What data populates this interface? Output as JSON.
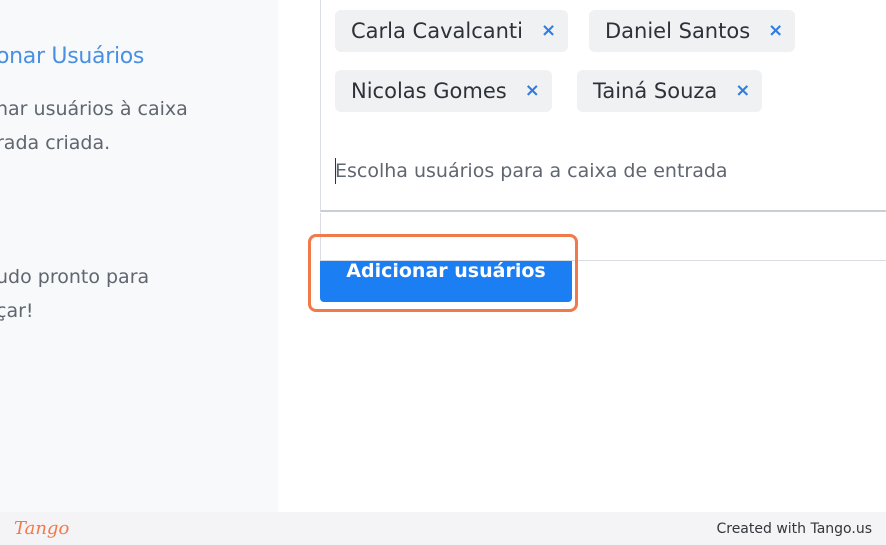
{
  "wizard": {
    "step_title": "onar Usuários",
    "step_desc_line1": "nar usuários à caixa",
    "step_desc_line2": "rada criada.",
    "ready_line1": "udo pronto para",
    "ready_line2": "çar!"
  },
  "selector": {
    "selected_users": [
      {
        "label": "Carla Cavalcanti",
        "remove": "×"
      },
      {
        "label": "Daniel Santos",
        "remove": "×"
      },
      {
        "label": "Nicolas Gomes",
        "remove": "×"
      },
      {
        "label": "Tainá Souza",
        "remove": "×"
      }
    ],
    "placeholder": "Escolha usuários para a caixa de entrada"
  },
  "actions": {
    "add_users_label": "Adicionar usuários"
  },
  "footer": {
    "logo": "Tango",
    "credit": "Created with Tango.us"
  },
  "colors": {
    "accent": "#1b7ef2",
    "highlight": "#f07a4a",
    "title_blue": "#4a90e2",
    "chip_bg": "#f0f1f3"
  }
}
